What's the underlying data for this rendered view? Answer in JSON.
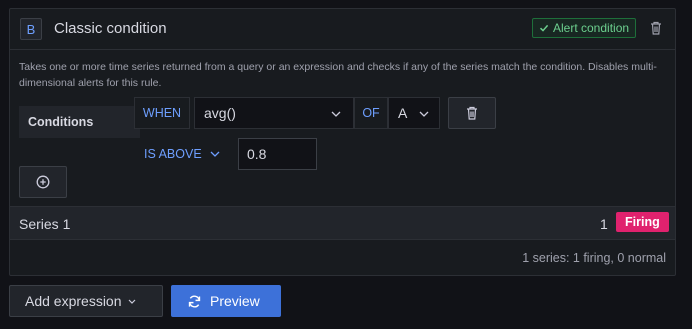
{
  "header": {
    "ref_id": "B",
    "title": "Classic condition",
    "alert_badge": "Alert condition"
  },
  "description": "Takes one or more time series returned from a query or an expression and checks if any of the series match the condition. Disables multi-dimensional alerts for this rule.",
  "condition": {
    "label": "Conditions",
    "when_label": "WHEN",
    "reducer_value": "avg()",
    "of_label": "OF",
    "query_value": "A",
    "evaluator_label": "IS ABOVE",
    "threshold_value": "0.8"
  },
  "series": {
    "name": "Series 1",
    "count": "1",
    "state": "Firing"
  },
  "summary": "1 series: 1 firing, 0 normal",
  "footer": {
    "add_expression_label": "Add expression",
    "preview_label": "Preview"
  },
  "icons": [
    "check-icon",
    "trash-icon",
    "chevron-down-icon",
    "plus-circle-icon",
    "sync-icon"
  ],
  "colors": {
    "accent_blue": "#6e9fff",
    "firing": "#e0226e",
    "success": "#6ccf8e",
    "primary_button": "#3d71d9"
  }
}
